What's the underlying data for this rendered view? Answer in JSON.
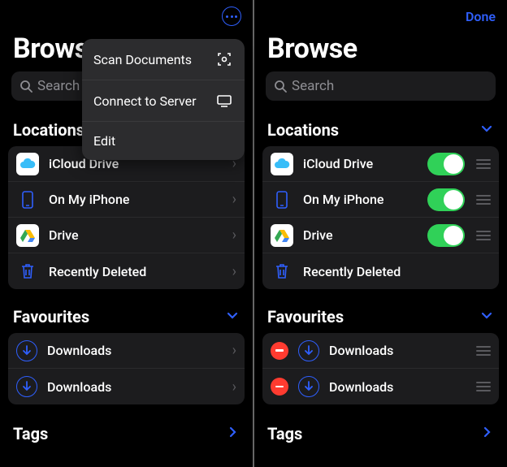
{
  "left": {
    "title": "Browse",
    "search_placeholder": "Search",
    "popover": {
      "scan": "Scan Documents",
      "connect": "Connect to Server",
      "edit": "Edit"
    },
    "locations_title": "Locations",
    "locations": [
      {
        "label": "iCloud Drive"
      },
      {
        "label": "On My iPhone"
      },
      {
        "label": "Drive"
      },
      {
        "label": "Recently Deleted"
      }
    ],
    "favourites_title": "Favourites",
    "favourites": [
      {
        "label": "Downloads"
      },
      {
        "label": "Downloads"
      }
    ],
    "tags_title": "Tags"
  },
  "right": {
    "done": "Done",
    "title": "Browse",
    "search_placeholder": "Search",
    "locations_title": "Locations",
    "locations": [
      {
        "label": "iCloud Drive",
        "toggle": true
      },
      {
        "label": "On My iPhone",
        "toggle": true
      },
      {
        "label": "Drive",
        "toggle": true
      },
      {
        "label": "Recently Deleted",
        "toggle": false
      }
    ],
    "favourites_title": "Favourites",
    "favourites": [
      {
        "label": "Downloads"
      },
      {
        "label": "Downloads"
      }
    ],
    "tags_title": "Tags"
  }
}
